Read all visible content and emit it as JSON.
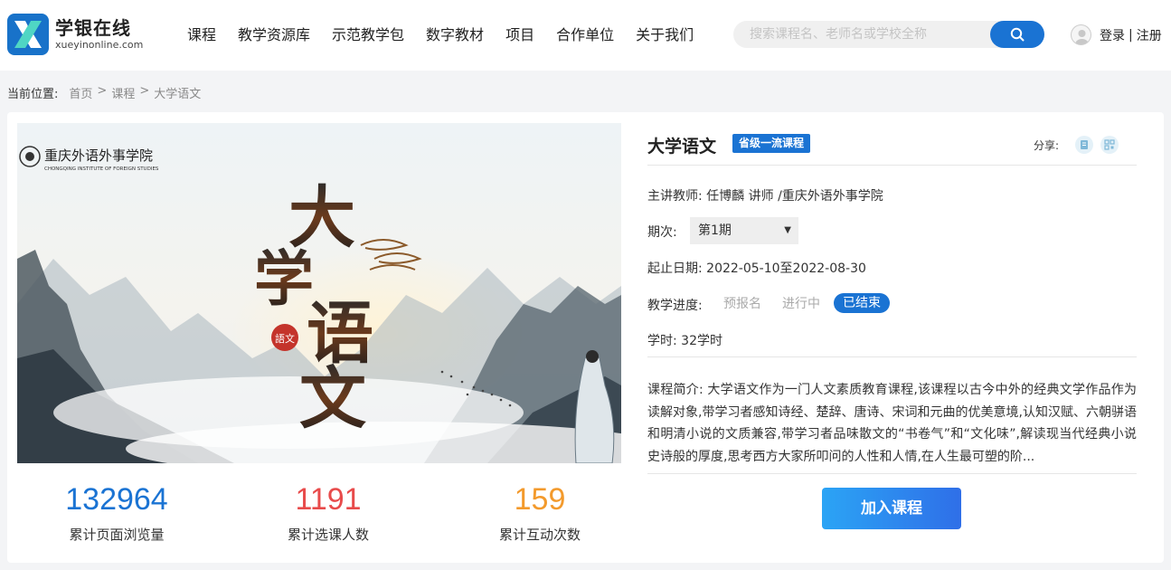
{
  "header": {
    "logo_cn": "学银在线",
    "logo_en": "xueyinonline.com",
    "nav": [
      "课程",
      "教学资源库",
      "示范教学包",
      "数字教材",
      "项目",
      "合作单位",
      "关于我们"
    ],
    "search_placeholder": "搜索课程名、老师名或学校全称",
    "login": "登录",
    "separator": "|",
    "register": "注册"
  },
  "breadcrumb": {
    "label": "当前位置:",
    "items": [
      "首页",
      "课程",
      "大学语文"
    ],
    "arrow": ">"
  },
  "cover": {
    "school_cn": "重庆外语外事学院",
    "school_en": "CHONGQING INSTITUTE OF FOREIGN STUDIES",
    "big_chars": [
      "大",
      "学",
      "语",
      "文"
    ],
    "seal": "語文"
  },
  "stats": [
    {
      "value": "132964",
      "label": "累计页面浏览量",
      "color": "#1a73d3"
    },
    {
      "value": "1191",
      "label": "累计选课人数",
      "color": "#e84b4b"
    },
    {
      "value": "159",
      "label": "累计互动次数",
      "color": "#f39a2c"
    }
  ],
  "course": {
    "title": "大学语文",
    "badge": "省级一流课程",
    "share_label": "分享:",
    "teacher_label": "主讲教师:",
    "teacher_value": "任博麟 讲师 /重庆外语外事学院",
    "term_label": "期次:",
    "term_value": "第1期",
    "date_label": "起止日期:",
    "date_value": "2022-05-10至2022-08-30",
    "progress_label": "教学进度:",
    "progress_items": [
      "预报名",
      "进行中",
      "已结束"
    ],
    "hours_label": "学时:",
    "hours_value": "32学时",
    "intro_label": "课程简介:",
    "intro_text": "大学语文作为一门人文素质教育课程,该课程以古今中外的经典文学作品作为读解对象,带学习者感知诗经、楚辞、唐诗、宋词和元曲的优美意境,认知汉赋、六朝骈语和明清小说的文质兼容,带学习者品味散文的“书卷气”和“文化味”,解读现当代经典小说史诗般的厚度,思考西方大家所叩问的人性和人情,在人生最可塑的阶...",
    "join_button": "加入课程"
  },
  "colors": {
    "accent": "#1a73d3",
    "stat_blue": "#1a73d3",
    "stat_red": "#e84b4b",
    "stat_orange": "#f39a2c"
  }
}
